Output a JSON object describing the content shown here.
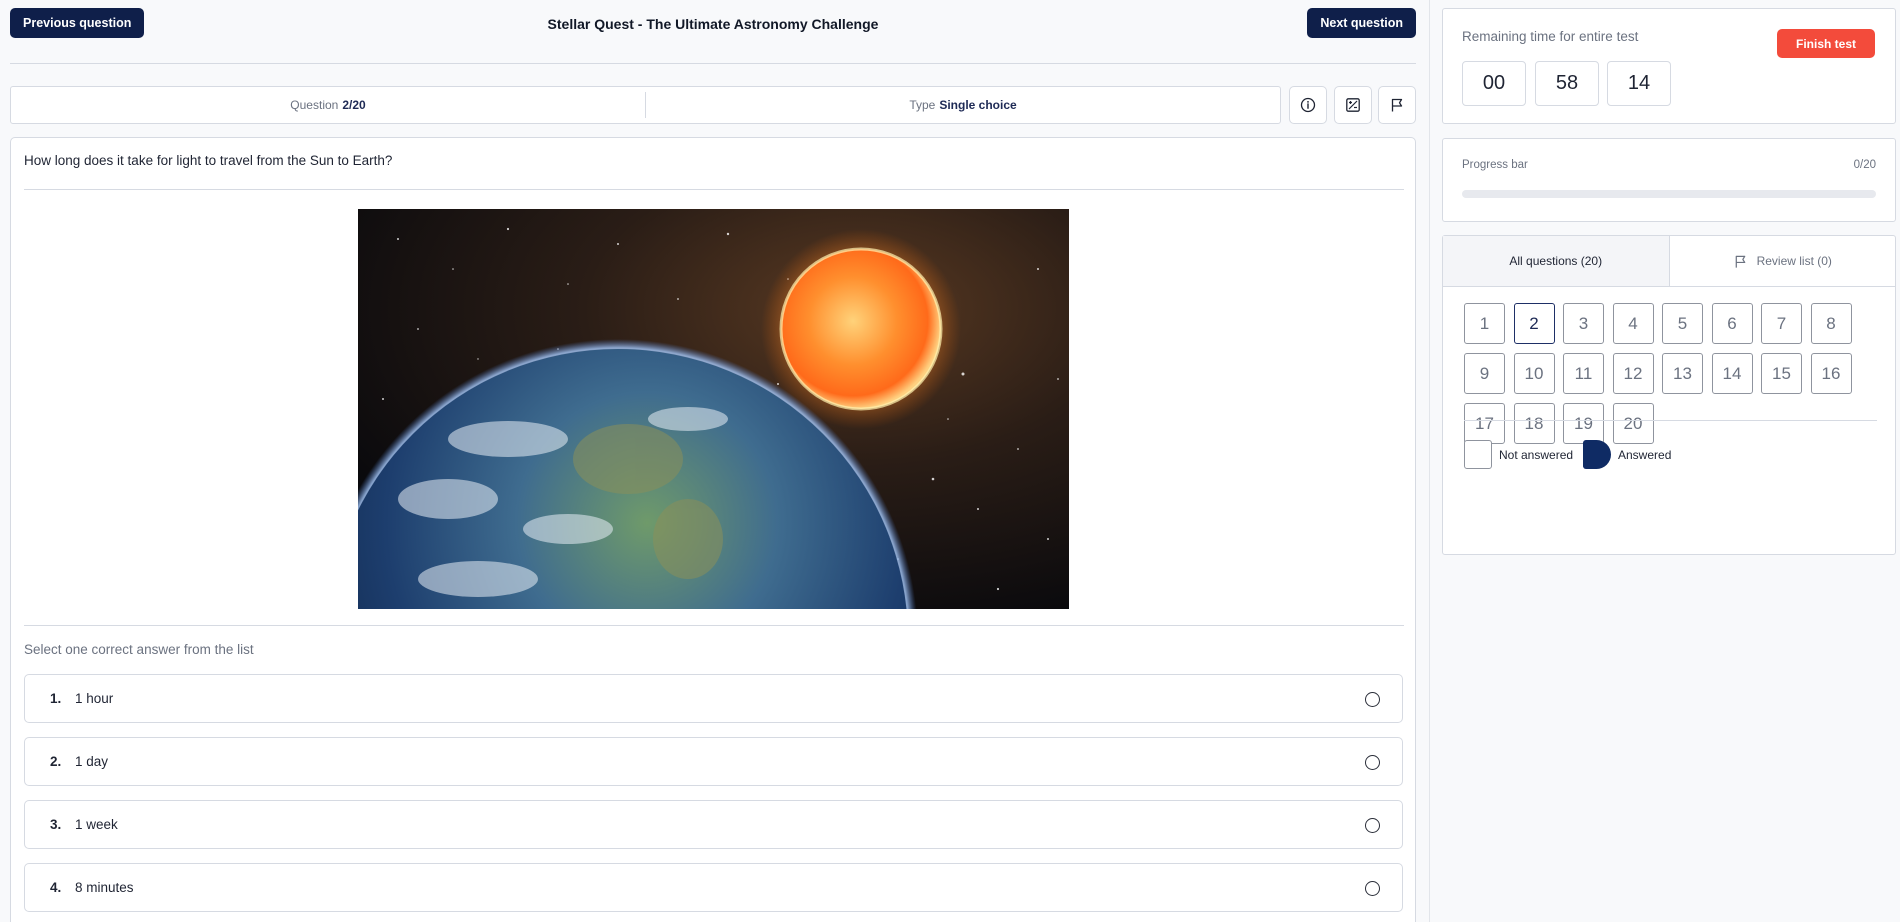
{
  "header": {
    "prev_label": "Previous question",
    "next_label": "Next question",
    "title": "Stellar Quest - The Ultimate Astronomy Challenge"
  },
  "meta": {
    "question_label": "Question",
    "question_value": "2/20",
    "type_label": "Type",
    "type_value": "Single choice"
  },
  "toolbar_icons": [
    "info-icon",
    "calculator-icon",
    "flag-icon"
  ],
  "question": {
    "text": "How long does it take for light to travel from the Sun to Earth?",
    "image_alt": "Earth and Sun in space",
    "instruction": "Select one correct answer from the list",
    "options": [
      {
        "num": "1.",
        "text": "1 hour"
      },
      {
        "num": "2.",
        "text": "1 day"
      },
      {
        "num": "3.",
        "text": "1 week"
      },
      {
        "num": "4.",
        "text": "8 minutes"
      }
    ]
  },
  "timer": {
    "label": "Remaining time for entire test",
    "finish_label": "Finish test",
    "hours": "00",
    "minutes": "58",
    "seconds": "14"
  },
  "progress": {
    "label": "Progress bar",
    "count": "0/20",
    "fraction": 0
  },
  "navigator": {
    "tab_all": "All questions (20)",
    "tab_review": "Review list (0)",
    "questions": [
      "1",
      "2",
      "3",
      "4",
      "5",
      "6",
      "7",
      "8",
      "9",
      "10",
      "11",
      "12",
      "13",
      "14",
      "15",
      "16",
      "17",
      "18",
      "19",
      "20"
    ],
    "current": "2",
    "legend_not_answered": "Not answered",
    "legend_answered": "Answered"
  },
  "colors": {
    "primary": "#0f1f4a",
    "danger": "#f34b3b",
    "answered": "#0f2b64"
  }
}
